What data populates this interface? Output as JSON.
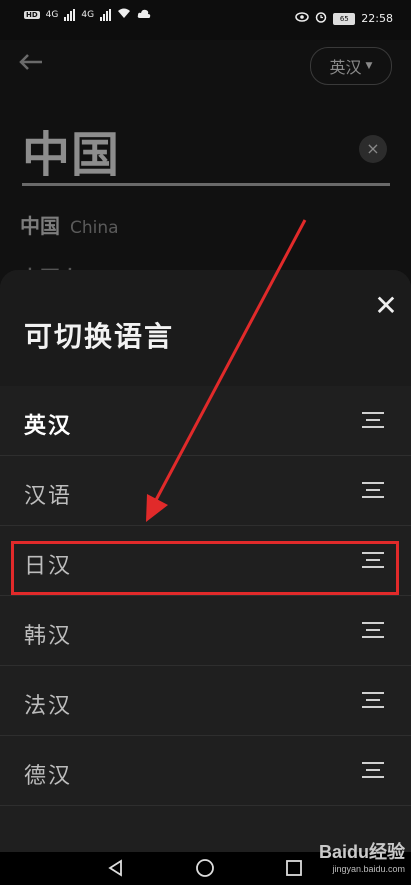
{
  "status_bar": {
    "network_left": "4G",
    "network_right": "4G",
    "battery": "65",
    "time": "22:58"
  },
  "background_page": {
    "language_selector": "英汉",
    "query": "中国",
    "suggestion_word": "中国",
    "suggestion_translation": "China",
    "suggestion_partial": "中国人"
  },
  "sheet": {
    "title": "可切换语言",
    "items": [
      {
        "label": "英汉",
        "active": true
      },
      {
        "label": "汉语",
        "active": false
      },
      {
        "label": "日汉",
        "active": false
      },
      {
        "label": "韩汉",
        "active": false
      },
      {
        "label": "法汉",
        "active": false
      },
      {
        "label": "德汉",
        "active": false
      }
    ]
  },
  "watermark": {
    "brand": "Baidu经验",
    "url": "jingyan.baidu.com"
  },
  "colors": {
    "highlight": "#e12a2a",
    "sheet_bg": "#1f1f1f"
  }
}
